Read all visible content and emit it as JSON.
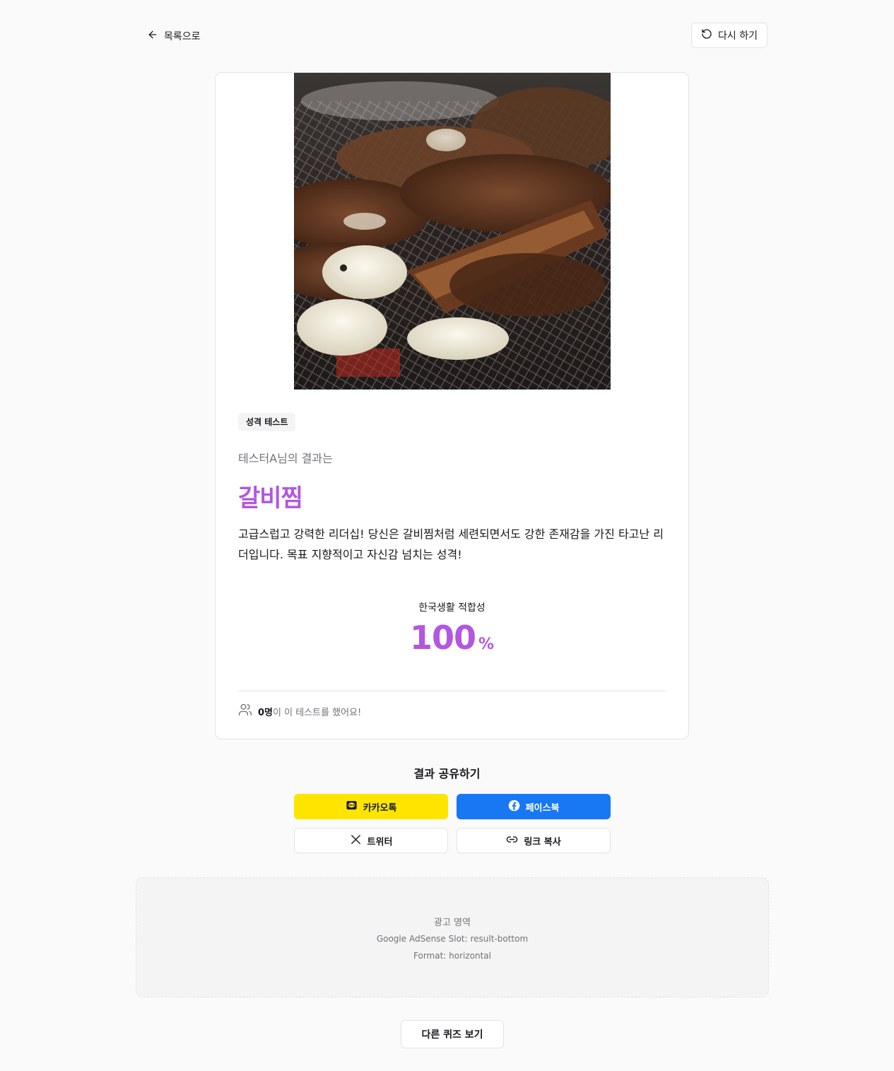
{
  "nav": {
    "back_label": "목록으로",
    "retry_label": "다시 하기"
  },
  "result": {
    "badge": "성격 테스트",
    "subtitle": "테스터A님의 결과는",
    "title": "갈비찜",
    "description": "고급스럽고 강력한 리더십! 당신은 갈비찜처럼 세련되면서도 강한 존재감을 가진 타고난 리더입니다. 목표 지향적이고 자신감 넘치는 성격!",
    "score_label": "한국생활 적합성",
    "score_value": "100",
    "score_unit": "%",
    "participants_count": "0명",
    "participants_suffix": "이 이 테스트를 했어요!",
    "accent_color": "#b356e0"
  },
  "share": {
    "title": "결과 공유하기",
    "kakao_label": "카카오톡",
    "facebook_label": "페이스북",
    "twitter_label": "트위터",
    "link_label": "링크 복사",
    "kakao_color": "#fee500",
    "facebook_color": "#1877f2"
  },
  "ad": {
    "title": "광고 영역",
    "slot": "Google AdSense Slot: result-bottom",
    "format": "Format: horizontal"
  },
  "footer": {
    "other_quiz_label": "다른 퀴즈 보기"
  }
}
